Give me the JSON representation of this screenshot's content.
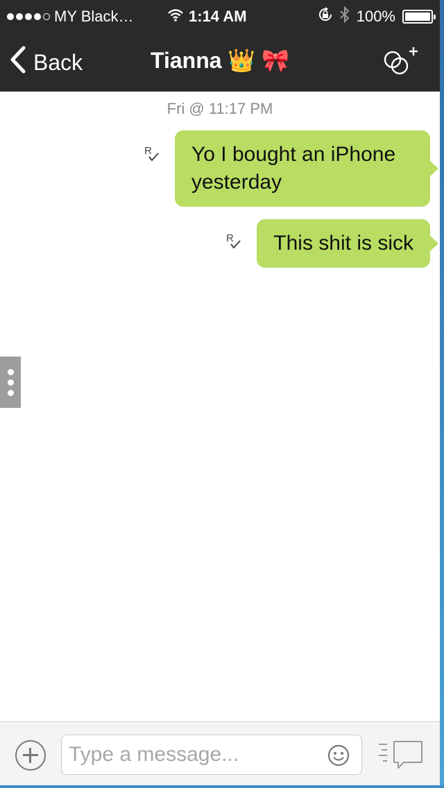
{
  "status_bar": {
    "carrier": "MY Black…",
    "time": "1:14 AM",
    "battery_percent": "100%",
    "signal_bars_filled": 4,
    "signal_bars_total": 5,
    "icons": [
      "wifi-icon",
      "orientation-lock-icon",
      "bluetooth-icon",
      "battery-icon"
    ]
  },
  "nav": {
    "back_label": "Back",
    "title": "Tianna 👑 🎀",
    "add_icon": "add-group-icon"
  },
  "conversation": {
    "timestamp": "Fri @ 11:17 PM",
    "messages": [
      {
        "text_line1": "Yo I bought an iPhone",
        "text_line2": "yesterday",
        "read_mark": "R"
      },
      {
        "text_line1": "This shit is sick",
        "read_mark": "R"
      }
    ]
  },
  "composer": {
    "placeholder": "Type a message...",
    "plus_icon": "plus-icon",
    "emoji_icon": "emoji-icon",
    "send_icon": "send-icon"
  },
  "colors": {
    "bar_background": "#2a2a2a",
    "bubble_green": "#b8dd62",
    "frame_blue": "#3d8ec4"
  }
}
